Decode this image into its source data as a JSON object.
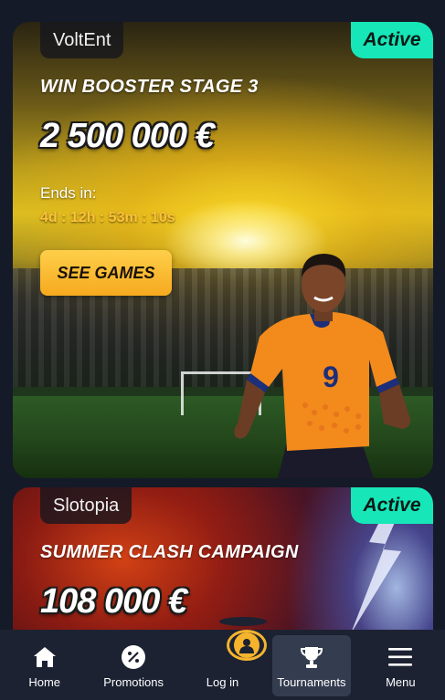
{
  "cards": [
    {
      "provider": "VoltEnt",
      "status": "Active",
      "title": "WIN BOOSTER STAGE 3",
      "prize": "2 500 000 €",
      "ends_label": "Ends in:",
      "countdown": "4d : 12h : 53m : 10s",
      "cta_label": "SEE GAMES",
      "player_number": "9"
    },
    {
      "provider": "Slotopia",
      "status": "Active",
      "title": "SUMMER CLASH CAMPAIGN",
      "prize": "108 000 €"
    }
  ],
  "bottom_nav": {
    "items": [
      {
        "label": "Home",
        "icon": "home-icon"
      },
      {
        "label": "Promotions",
        "icon": "percent-icon"
      },
      {
        "label": "Log in",
        "icon": "user-icon"
      },
      {
        "label": "Tournaments",
        "icon": "trophy-icon",
        "selected": true
      },
      {
        "label": "Menu",
        "icon": "hamburger-menu-icon"
      }
    ]
  },
  "colors": {
    "active_badge": "#17e6b8",
    "cta_button": "#f6a91f",
    "countdown_text": "#ffc23a",
    "login_ring": "#f5b42c",
    "nav_bg": "#1c2232",
    "page_bg": "#141a27"
  }
}
